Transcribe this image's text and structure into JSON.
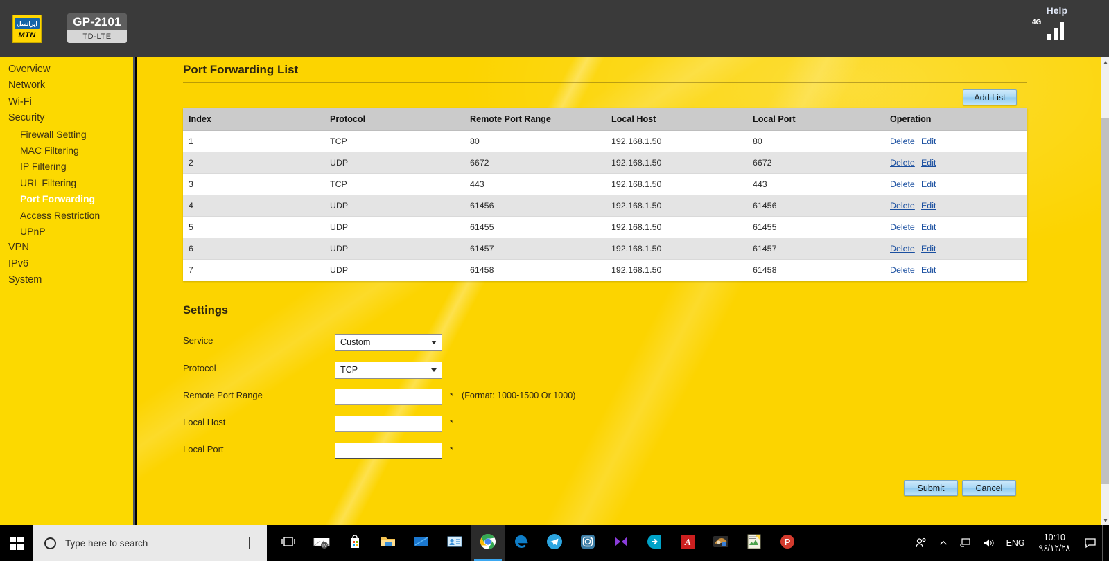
{
  "header": {
    "brand_logo": "irancell-mtn-logo",
    "brand_top_text": "ایرانسل",
    "brand_bottom_text": "MTN",
    "model_name": "GP-2101",
    "model_sub": "TD-LTE",
    "help_label": "Help",
    "network_type": "4G",
    "signal_bars": 3,
    "colors": {
      "bar_bg": "#3a3a3a",
      "accent_yellow": "#fcd400"
    }
  },
  "sidebar": {
    "items": [
      {
        "label": "Overview",
        "level": 0,
        "active": false
      },
      {
        "label": "Network",
        "level": 0,
        "active": false
      },
      {
        "label": "Wi-Fi",
        "level": 0,
        "active": false
      },
      {
        "label": "Security",
        "level": 0,
        "active": false
      },
      {
        "label": "Firewall Setting",
        "level": 1,
        "active": false
      },
      {
        "label": "MAC Filtering",
        "level": 1,
        "active": false
      },
      {
        "label": "IP Filtering",
        "level": 1,
        "active": false
      },
      {
        "label": "URL Filtering",
        "level": 1,
        "active": false
      },
      {
        "label": "Port Forwarding",
        "level": 1,
        "active": true
      },
      {
        "label": "Access Restriction",
        "level": 1,
        "active": false
      },
      {
        "label": "UPnP",
        "level": 1,
        "active": false
      },
      {
        "label": "VPN",
        "level": 0,
        "active": false
      },
      {
        "label": "IPv6",
        "level": 0,
        "active": false
      },
      {
        "label": "System",
        "level": 0,
        "active": false
      }
    ]
  },
  "main": {
    "page_title": "Port Forwarding List",
    "add_list_label": "Add List",
    "table": {
      "columns": [
        "Index",
        "Protocol",
        "Remote Port Range",
        "Local Host",
        "Local Port",
        "Operation"
      ],
      "rows": [
        {
          "index": "1",
          "protocol": "TCP",
          "remote_port_range": "80",
          "local_host": "192.168.1.50",
          "local_port": "80"
        },
        {
          "index": "2",
          "protocol": "UDP",
          "remote_port_range": "6672",
          "local_host": "192.168.1.50",
          "local_port": "6672"
        },
        {
          "index": "3",
          "protocol": "TCP",
          "remote_port_range": "443",
          "local_host": "192.168.1.50",
          "local_port": "443"
        },
        {
          "index": "4",
          "protocol": "UDP",
          "remote_port_range": "61456",
          "local_host": "192.168.1.50",
          "local_port": "61456"
        },
        {
          "index": "5",
          "protocol": "UDP",
          "remote_port_range": "61455",
          "local_host": "192.168.1.50",
          "local_port": "61455"
        },
        {
          "index": "6",
          "protocol": "UDP",
          "remote_port_range": "61457",
          "local_host": "192.168.1.50",
          "local_port": "61457"
        },
        {
          "index": "7",
          "protocol": "UDP",
          "remote_port_range": "61458",
          "local_host": "192.168.1.50",
          "local_port": "61458"
        }
      ],
      "op_delete_label": "Delete",
      "op_separator": "|",
      "op_edit_label": "Edit"
    },
    "settings": {
      "title": "Settings",
      "service": {
        "label": "Service",
        "value": "Custom"
      },
      "protocol": {
        "label": "Protocol",
        "value": "TCP"
      },
      "remote_port_range": {
        "label": "Remote Port Range",
        "value": "",
        "placeholder": "",
        "required_mark": "*",
        "hint": "(Format: 1000-1500 Or 1000)"
      },
      "local_host": {
        "label": "Local Host",
        "value": "",
        "placeholder": "",
        "required_mark": "*"
      },
      "local_port": {
        "label": "Local Port",
        "value": "",
        "placeholder": "",
        "required_mark": "*",
        "focused": true
      },
      "submit_label": "Submit",
      "cancel_label": "Cancel"
    }
  },
  "taskbar": {
    "start_icon": "windows-logo-icon",
    "search_placeholder": "Type here to search",
    "mic_icon": "microphone-icon",
    "apps": [
      {
        "name": "task-view-icon",
        "glyph": "▯"
      },
      {
        "name": "mail-icon",
        "glyph": "✉"
      },
      {
        "name": "microsoft-store-icon",
        "glyph": "🛍"
      },
      {
        "name": "file-explorer-icon",
        "glyph": "🗀"
      },
      {
        "name": "movies-tv-icon",
        "glyph": "▭"
      },
      {
        "name": "people-contacts-icon",
        "glyph": "▤"
      },
      {
        "name": "google-chrome-icon",
        "glyph": "◎"
      },
      {
        "name": "microsoft-edge-icon",
        "glyph": "e"
      },
      {
        "name": "telegram-icon",
        "glyph": "✈"
      },
      {
        "name": "instagram-icon",
        "glyph": "◻"
      },
      {
        "name": "media-player-icon",
        "glyph": "▶"
      },
      {
        "name": "free-download-manager-icon",
        "glyph": "➡"
      },
      {
        "name": "adobe-acrobat-icon",
        "glyph": "A"
      },
      {
        "name": "game-icon",
        "glyph": "✥"
      },
      {
        "name": "notepad-plus-plus-icon",
        "glyph": "▦"
      },
      {
        "name": "potplayer-icon",
        "glyph": "P"
      }
    ],
    "tray": {
      "people_icon": "people-icon",
      "chevron_icon": "show-hidden-icons-chevron",
      "network_icon": "network-icon",
      "volume_icon": "volume-icon",
      "language": "ENG",
      "time": "10:10",
      "date": "۹۶/۱۲/۲۸",
      "action_center_icon": "action-center-icon"
    }
  },
  "scrollbar": {
    "up_arrow": "scroll-up-arrow",
    "down_arrow": "scroll-down-arrow",
    "thumb": "scroll-thumb"
  }
}
